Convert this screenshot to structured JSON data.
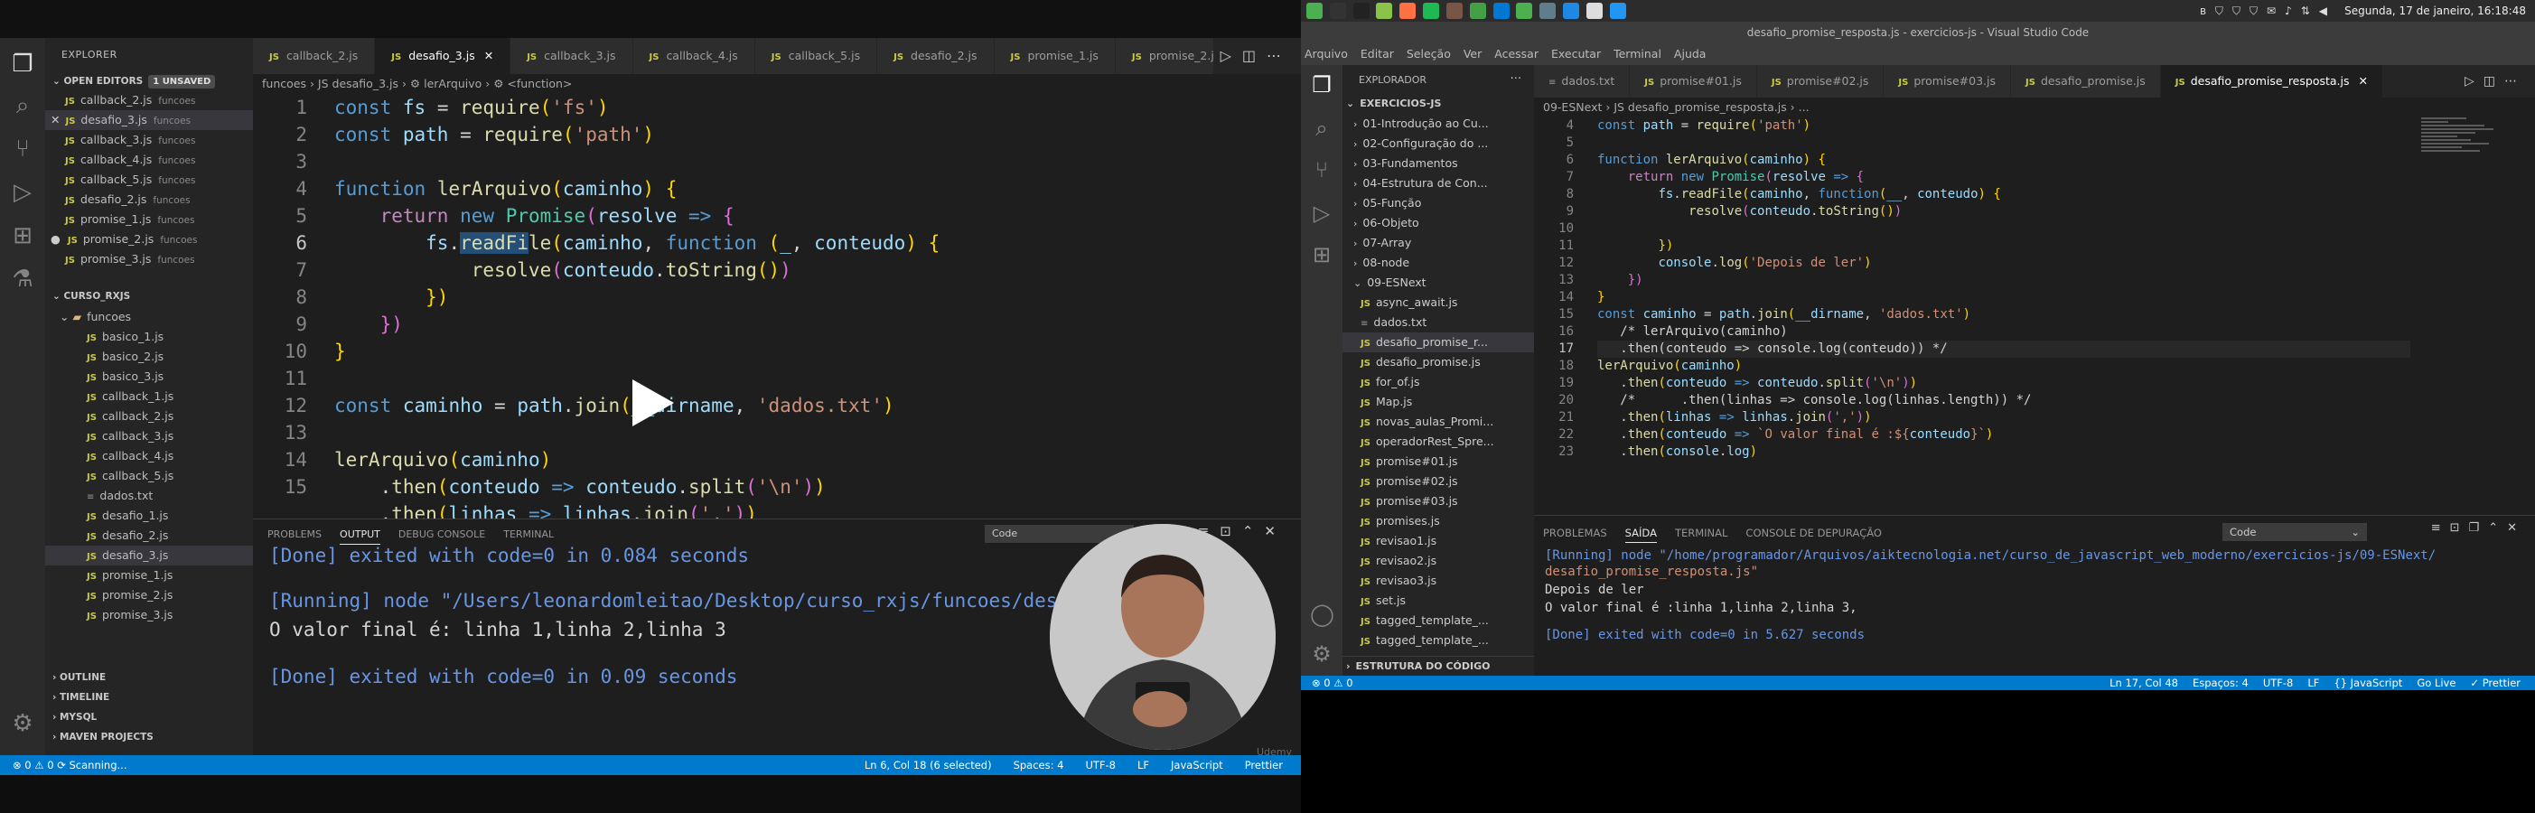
{
  "left": {
    "explorer_title": "EXPLORER",
    "open_editors": {
      "header": "OPEN EDITORS",
      "badge": "1 UNSAVED",
      "items": [
        {
          "name": "callback_2.js",
          "folder": "funcoes"
        },
        {
          "name": "desafio_3.js",
          "folder": "funcoes"
        },
        {
          "name": "callback_3.js",
          "folder": "funcoes"
        },
        {
          "name": "callback_4.js",
          "folder": "funcoes"
        },
        {
          "name": "callback_5.js",
          "folder": "funcoes"
        },
        {
          "name": "desafio_2.js",
          "folder": "funcoes"
        },
        {
          "name": "promise_1.js",
          "folder": "funcoes"
        },
        {
          "name": "promise_2.js",
          "folder": "funcoes"
        },
        {
          "name": "promise_3.js",
          "folder": "funcoes"
        }
      ]
    },
    "project": {
      "header": "CURSO_RXJS",
      "folder": "funcoes",
      "files": [
        "basico_1.js",
        "basico_2.js",
        "basico_3.js",
        "callback_1.js",
        "callback_2.js",
        "callback_3.js",
        "callback_4.js",
        "callback_5.js",
        "dados.txt",
        "desafio_1.js",
        "desafio_2.js",
        "desafio_3.js",
        "promise_1.js",
        "promise_2.js",
        "promise_3.js"
      ]
    },
    "bottom_sections": [
      "OUTLINE",
      "TIMELINE",
      "MYSQL",
      "MAVEN PROJECTS"
    ],
    "tabs": [
      "callback_2.js",
      "desafio_3.js",
      "callback_3.js",
      "callback_4.js",
      "callback_5.js",
      "desafio_2.js",
      "promise_1.js",
      "promise_2.js"
    ],
    "breadcrumb": "funcoes › JS desafio_3.js › ⚙ lerArquivo › ⚙ <function>",
    "code_lines": [
      "1",
      "2",
      "3",
      "4",
      "5",
      "6",
      "7",
      "8",
      "9",
      "10",
      "11",
      "12",
      "13",
      "14",
      "15"
    ],
    "panel": {
      "tabs": [
        "PROBLEMS",
        "OUTPUT",
        "DEBUG CONSOLE",
        "TERMINAL"
      ],
      "dropdown": "Code",
      "lines": [
        {
          "text": "[Done] exited with code=0 in 0.084 seconds",
          "color": "#6796e6"
        },
        {
          "text": "[Running] node \"/Users/leonardomleitao/Desktop/curso_rxjs/funcoes/desafio_3.js\"",
          "color": "#6796e6"
        },
        {
          "text": "O valor final é: linha 1,linha 2,linha 3",
          "color": "#d4d4d4"
        },
        {
          "text": "[Done] exited with code=0 in 0.09 seconds",
          "color": "#6796e6"
        }
      ]
    },
    "status": {
      "left": "⊗ 0 ⚠ 0 ⟳ Scanning...",
      "items": [
        "Ln 6, Col 18 (6 selected)",
        "Spaces: 4",
        "UTF-8",
        "LF",
        "JavaScript",
        "Prettier"
      ]
    },
    "watermark": "Udemy"
  },
  "right": {
    "clock": "Segunda, 17 de janeiro, 16:18:48",
    "window_title": "desafio_promise_resposta.js - exercicios-js - Visual Studio Code",
    "menu": [
      "Arquivo",
      "Editar",
      "Seleção",
      "Ver",
      "Acessar",
      "Executar",
      "Terminal",
      "Ajuda"
    ],
    "explorer_title": "EXPLORADOR",
    "root": "EXERCICIOS-JS",
    "folders": [
      "01-Introdução ao Cu...",
      "02-Configuração do ...",
      "03-Fundamentos",
      "04-Estrutura de Con...",
      "05-Função",
      "06-Objeto",
      "07-Array",
      "08-node"
    ],
    "open_folder": "09-ESNext",
    "files": [
      {
        "name": "async_await.js",
        "type": "js"
      },
      {
        "name": "dados.txt",
        "type": "txt"
      },
      {
        "name": "desafio_promise_r...",
        "type": "js"
      },
      {
        "name": "desafio_promise.js",
        "type": "js"
      },
      {
        "name": "for_of.js",
        "type": "js"
      },
      {
        "name": "Map.js",
        "type": "js"
      },
      {
        "name": "novas_aulas_Promi...",
        "type": "js"
      },
      {
        "name": "operadorRest_Spre...",
        "type": "js"
      },
      {
        "name": "promise#01.js",
        "type": "js"
      },
      {
        "name": "promise#02.js",
        "type": "js"
      },
      {
        "name": "promise#03.js",
        "type": "js"
      },
      {
        "name": "promises.js",
        "type": "js"
      },
      {
        "name": "revisao1.js",
        "type": "js"
      },
      {
        "name": "revisao2.js",
        "type": "js"
      },
      {
        "name": "revisao3.js",
        "type": "js"
      },
      {
        "name": "set.js",
        "type": "js"
      },
      {
        "name": "tagged_template_...",
        "type": "js"
      },
      {
        "name": "tagged_template_...",
        "type": "js"
      }
    ],
    "outline": "ESTRUTURA DO CÓDIGO",
    "tabs": [
      "dados.txt",
      "promise#01.js",
      "promise#02.js",
      "promise#03.js",
      "desafio_promise.js",
      "desafio_promise_resposta.js"
    ],
    "breadcrumb": "09-ESNext › JS desafio_promise_resposta.js › ...",
    "code_lines": [
      "4",
      "5",
      "6",
      "7",
      "8",
      "9",
      "10",
      "11",
      "12",
      "13",
      "14",
      "15",
      "16",
      "17",
      "18",
      "19",
      "20",
      "21",
      "22",
      "23"
    ],
    "panel": {
      "tabs": [
        "PROBLEMAS",
        "SAÍDA",
        "TERMINAL",
        "CONSOLE DE DEPURAÇÃO"
      ],
      "dropdown": "Code",
      "lines": [
        {
          "text": "[Running] node \"/home/programador/Arquivos/aiktecnologia.net/curso_de_javascript_web_moderno/exercicios-js/09-ESNext/",
          "color": "#6796e6"
        },
        {
          "text": "desafio_promise_resposta.js\"",
          "color": "#ce9178"
        },
        {
          "text": "Depois de ler",
          "color": "#d4d4d4"
        },
        {
          "text": "O valor final é :linha 1,linha 2,linha 3,",
          "color": "#d4d4d4"
        },
        {
          "text": "[Done] exited with code=0 in 5.627 seconds",
          "color": "#6796e6"
        }
      ]
    },
    "status": {
      "left": "⊗ 0 ⚠ 0",
      "items": [
        "Ln 17, Col 48",
        "Espaços: 4",
        "UTF-8",
        "LF",
        "{} JavaScript",
        "Go Live",
        "✓ Prettier"
      ]
    }
  }
}
